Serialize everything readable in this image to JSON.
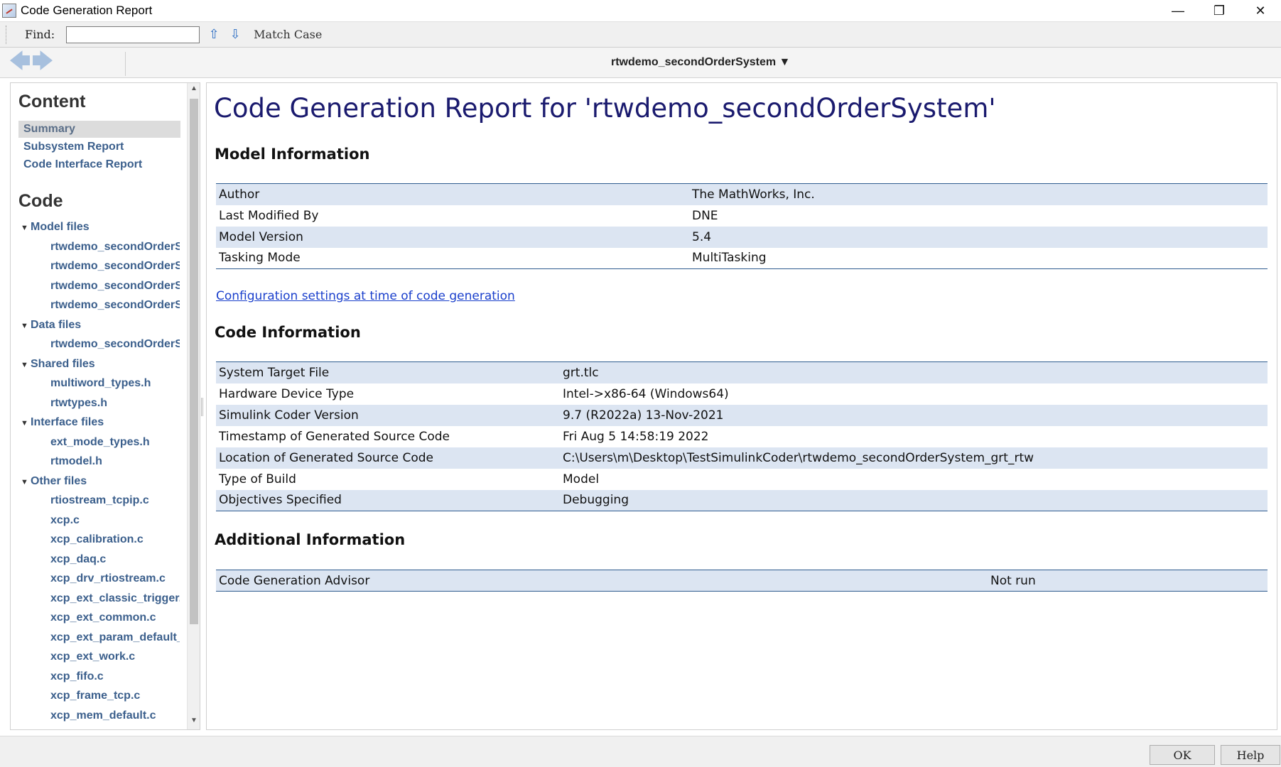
{
  "window": {
    "title": "Code Generation Report"
  },
  "find": {
    "label": "Find:",
    "value": "",
    "match_case": "Match Case"
  },
  "nav": {
    "model": "rtwdemo_secondOrderSystem ▼"
  },
  "sidebar": {
    "content_title": "Content",
    "content_links": [
      "Summary",
      "Subsystem Report",
      "Code Interface Report"
    ],
    "code_title": "Code",
    "groups": [
      {
        "label": "Model files",
        "files": [
          "rtwdemo_secondOrderSystem.c",
          "rtwdemo_secondOrderSystem.h",
          "rtwdemo_secondOrderSystem_private.h",
          "rtwdemo_secondOrderSystem_types.h"
        ]
      },
      {
        "label": "Data files",
        "files": [
          "rtwdemo_secondOrderSystem_data.c"
        ]
      },
      {
        "label": "Shared files",
        "files": [
          "multiword_types.h",
          "rtwtypes.h"
        ]
      },
      {
        "label": "Interface files",
        "files": [
          "ext_mode_types.h",
          "rtmodel.h"
        ]
      },
      {
        "label": "Other files",
        "files": [
          "rtiostream_tcpip.c",
          "xcp.c",
          "xcp_calibration.c",
          "xcp_daq.c",
          "xcp_drv_rtiostream.c",
          "xcp_ext_classic_trigger.c",
          "xcp_ext_common.c",
          "xcp_ext_param_default_tgt.c",
          "xcp_ext_work.c",
          "xcp_fifo.c",
          "xcp_frame_tcp.c",
          "xcp_mem_default.c"
        ]
      }
    ]
  },
  "report": {
    "title": "Code Generation Report for 'rtwdemo_secondOrderSystem'",
    "model_info_title": "Model Information",
    "model_info": [
      [
        "Author",
        "The MathWorks, Inc."
      ],
      [
        "Last Modified By",
        "DNE"
      ],
      [
        "Model Version",
        "5.4"
      ],
      [
        "Tasking Mode",
        "MultiTasking"
      ]
    ],
    "config_link": "Configuration settings at time of code generation",
    "code_info_title": "Code Information",
    "code_info": [
      [
        "System Target File",
        "grt.tlc"
      ],
      [
        "Hardware Device Type",
        "Intel->x86-64 (Windows64)"
      ],
      [
        "Simulink Coder Version",
        "9.7 (R2022a) 13-Nov-2021"
      ],
      [
        "Timestamp of Generated Source Code",
        "Fri Aug 5 14:58:19 2022"
      ],
      [
        "Location of Generated Source Code",
        "C:\\Users\\m\\Desktop\\TestSimulinkCoder\\rtwdemo_secondOrderSystem_grt_rtw"
      ],
      [
        "Type of Build",
        "Model"
      ],
      [
        "Objectives Specified",
        "Debugging"
      ]
    ],
    "additional_title": "Additional Information",
    "additional_info": [
      [
        "Code Generation Advisor",
        "Not run"
      ]
    ]
  },
  "buttons": {
    "ok": "OK",
    "help": "Help"
  },
  "colors": {
    "link": "#3b5f8c",
    "title": "#1a1a6e",
    "row_alt": "#dce5f2",
    "table_border": "#2f5c8f"
  }
}
